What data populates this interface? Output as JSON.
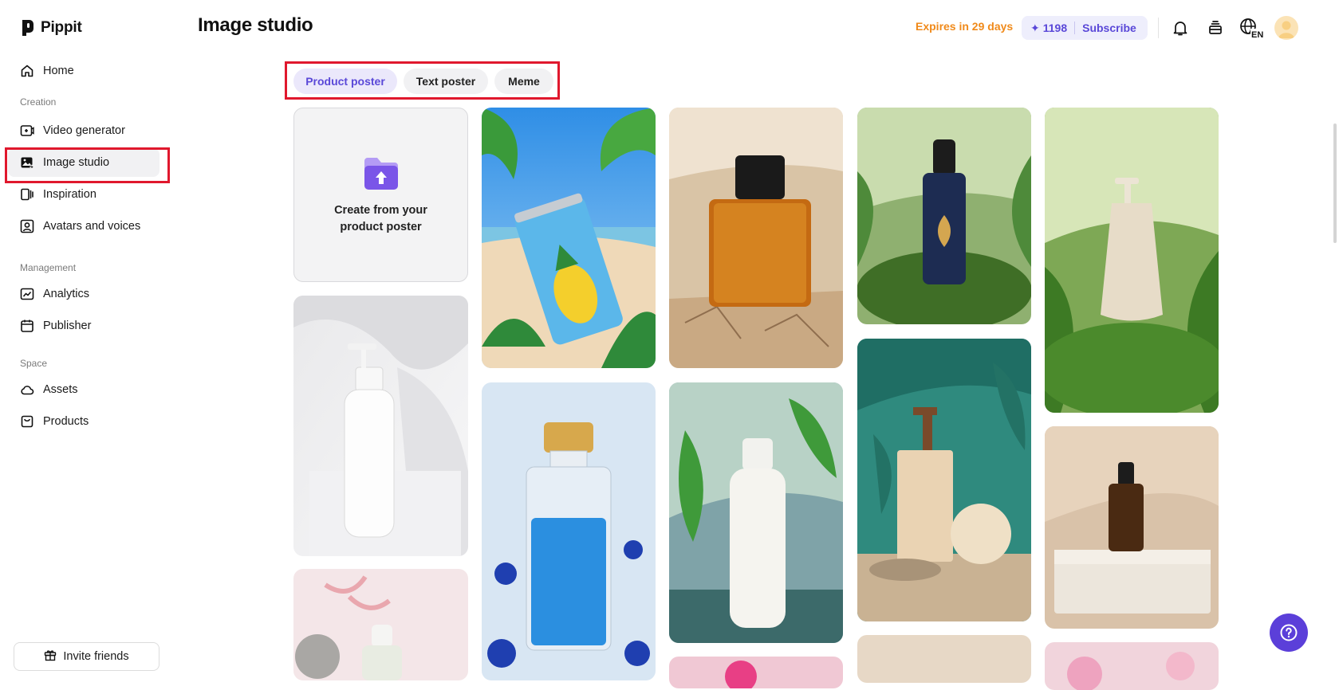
{
  "app": {
    "name": "Pippit"
  },
  "sidebar": {
    "home": "Home",
    "sections": {
      "creation": "Creation",
      "management": "Management",
      "space": "Space"
    },
    "items": [
      {
        "label": "Video generator",
        "icon": "video-plus-icon"
      },
      {
        "label": "Image studio",
        "icon": "image-sparkle-icon",
        "active": true
      },
      {
        "label": "Inspiration",
        "icon": "inspiration-icon"
      },
      {
        "label": "Avatars and voices",
        "icon": "avatar-icon"
      },
      {
        "label": "Analytics",
        "icon": "analytics-icon"
      },
      {
        "label": "Publisher",
        "icon": "calendar-icon"
      },
      {
        "label": "Assets",
        "icon": "cloud-icon"
      },
      {
        "label": "Products",
        "icon": "bag-icon"
      }
    ],
    "invite": "Invite friends"
  },
  "header": {
    "title": "Image studio",
    "expires": "Expires in 29 days",
    "credits": "1198",
    "subscribe": "Subscribe",
    "language": "EN"
  },
  "tabs": [
    {
      "label": "Product poster",
      "active": true
    },
    {
      "label": "Text poster",
      "active": false
    },
    {
      "label": "Meme",
      "active": false
    }
  ],
  "upload_card": {
    "text": "Create from your product poster"
  },
  "gallery": [
    "beach-pineapple-can",
    "amber-perfume-bottle",
    "dropper-bottle-moss",
    "pump-bottle-ferns",
    "white-pump-bottle",
    "blue-perfume-bottle",
    "white-bottle-water",
    "pump-soap-teal",
    "amber-dropper-stone",
    "pink-dropper-bottle",
    "pink-flower-partial",
    "beige-partial",
    "pink-flower-tile"
  ],
  "colors": {
    "accent": "#5a48d8",
    "expires": "#f08a1a",
    "highlight_box": "#e0182d",
    "help_button": "#5b3fd9"
  }
}
